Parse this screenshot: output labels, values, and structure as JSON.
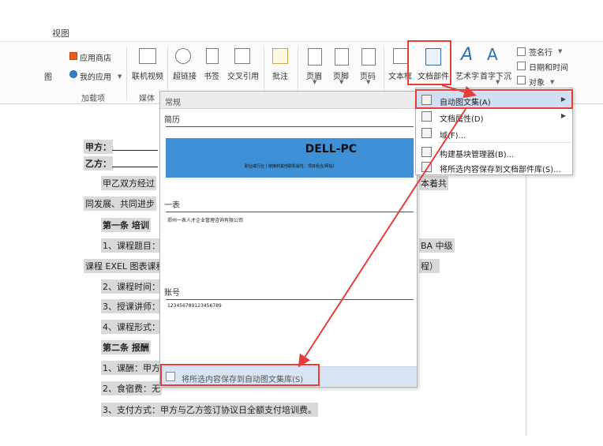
{
  "tab": "视图",
  "ribbon": {
    "left_partial": "图",
    "app_store": "应用商店",
    "my_apps": "我的应用",
    "addins_group": "加载项",
    "online_video": "联机视频",
    "media_group": "媒体",
    "hyperlink": "超链接",
    "bookmark": "书签",
    "cross_ref": "交叉引用",
    "comment": "批注",
    "header": "页眉",
    "footer": "页脚",
    "page_number": "页码",
    "textbox": "文本框",
    "quick_parts": "文档部件",
    "wordart": "艺术字",
    "dropcap": "首字下沉",
    "signature_line": "签名行",
    "date_time": "日期和时间",
    "object": "对象"
  },
  "document": {
    "party_a": "甲方：",
    "party_b": "乙方：",
    "p1_start": "甲乙双方经过",
    "p1_end": "本着共",
    "p2": "同发展、共同进步",
    "art1": "第一条 培训",
    "item1": "1、课程题目：",
    "item1_end": "BA 中级",
    "item1b": "课程 EXEL 图表课程",
    "item1b_end": "程）",
    "item2": "2、课程时间：",
    "item3": "3、授课讲师：",
    "item4": "4、课程形式：",
    "art2": "第二条 报酬",
    "fee1": "1、课酬：甲方",
    "fee2": "2、食宿费：无",
    "fee3": "3、支付方式：甲方与乙方签订协议日全额支付培训费。"
  },
  "gallery": {
    "header": "常规",
    "sec1": "简历",
    "dell_title": "DELL-PC",
    "banner_subtext": "职业或行业 | 链接到其他联机属性：项目组合/网站/",
    "sec2": "一表",
    "company": "郑州一表人才企业管理咨询有限公司",
    "sec3": "账号",
    "account": "123456789123456789",
    "save_label": "将所选内容保存到自动图文集库(S)"
  },
  "menu": {
    "items": [
      {
        "label": "自动图文集(A)",
        "submenu": true
      },
      {
        "label": "文档属性(D)",
        "submenu": true
      },
      {
        "label": "域(F)...",
        "submenu": false
      },
      {
        "label": "构建基块管理器(B)...",
        "submenu": false
      },
      {
        "label": "将所选内容保存到文档部件库(S)...",
        "submenu": false
      }
    ]
  },
  "colors": {
    "highlight_red": "#e53c3c",
    "banner_blue": "#3d8fd6",
    "menu_hover": "#cfe0f5",
    "doc_shade": "#d9d9d9"
  }
}
